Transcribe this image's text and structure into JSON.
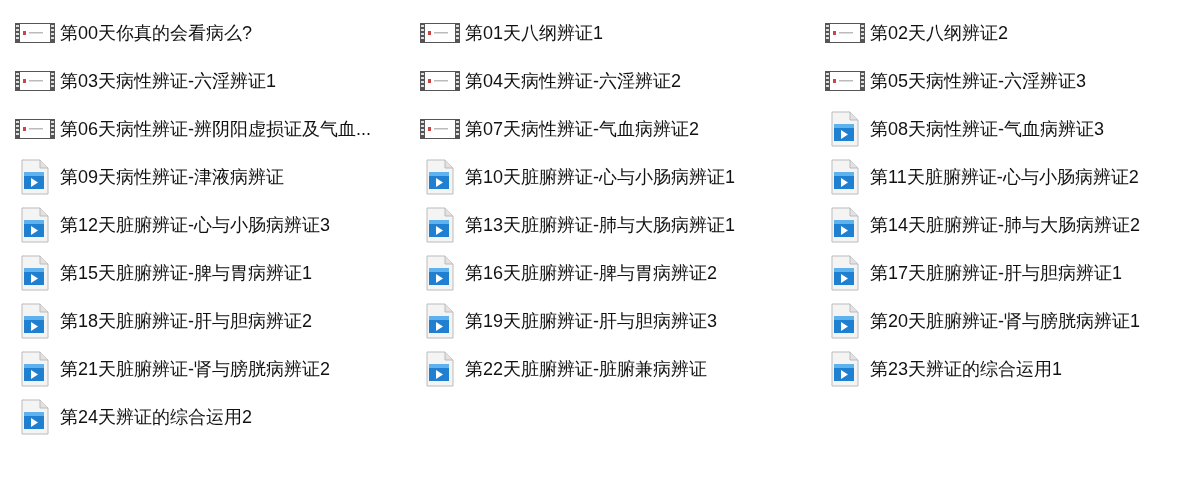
{
  "files": [
    {
      "name": "第00天你真的会看病么?",
      "kind": "thumbnail"
    },
    {
      "name": "第01天八纲辨证1",
      "kind": "thumbnail"
    },
    {
      "name": "第02天八纲辨证2",
      "kind": "thumbnail"
    },
    {
      "name": "第03天病性辨证-六淫辨证1",
      "kind": "thumbnail"
    },
    {
      "name": "第04天病性辨证-六淫辨证2",
      "kind": "thumbnail"
    },
    {
      "name": "第05天病性辨证-六淫辨证3",
      "kind": "thumbnail"
    },
    {
      "name": "第06天病性辨证-辨阴阳虚损证及气血...",
      "kind": "thumbnail"
    },
    {
      "name": "第07天病性辨证-气血病辨证2",
      "kind": "thumbnail"
    },
    {
      "name": "第08天病性辨证-气血病辨证3",
      "kind": "video"
    },
    {
      "name": "第09天病性辨证-津液病辨证",
      "kind": "video"
    },
    {
      "name": "第10天脏腑辨证-心与小肠病辨证1",
      "kind": "video"
    },
    {
      "name": "第11天脏腑辨证-心与小肠病辨证2",
      "kind": "video"
    },
    {
      "name": "第12天脏腑辨证-心与小肠病辨证3",
      "kind": "video"
    },
    {
      "name": "第13天脏腑辨证-肺与大肠病辨证1",
      "kind": "video"
    },
    {
      "name": "第14天脏腑辨证-肺与大肠病辨证2",
      "kind": "video"
    },
    {
      "name": "第15天脏腑辨证-脾与胃病辨证1",
      "kind": "video"
    },
    {
      "name": "第16天脏腑辨证-脾与胃病辨证2",
      "kind": "video"
    },
    {
      "name": "第17天脏腑辨证-肝与胆病辨证1",
      "kind": "video"
    },
    {
      "name": "第18天脏腑辨证-肝与胆病辨证2",
      "kind": "video"
    },
    {
      "name": "第19天脏腑辨证-肝与胆病辨证3",
      "kind": "video"
    },
    {
      "name": "第20天脏腑辨证-肾与膀胱病辨证1",
      "kind": "video"
    },
    {
      "name": "第21天脏腑辨证-肾与膀胱病辨证2",
      "kind": "video"
    },
    {
      "name": "第22天脏腑辨证-脏腑兼病辨证",
      "kind": "video"
    },
    {
      "name": "第23天辨证的综合运用1",
      "kind": "video"
    },
    {
      "name": "第24天辨证的综合运用2",
      "kind": "video"
    }
  ]
}
